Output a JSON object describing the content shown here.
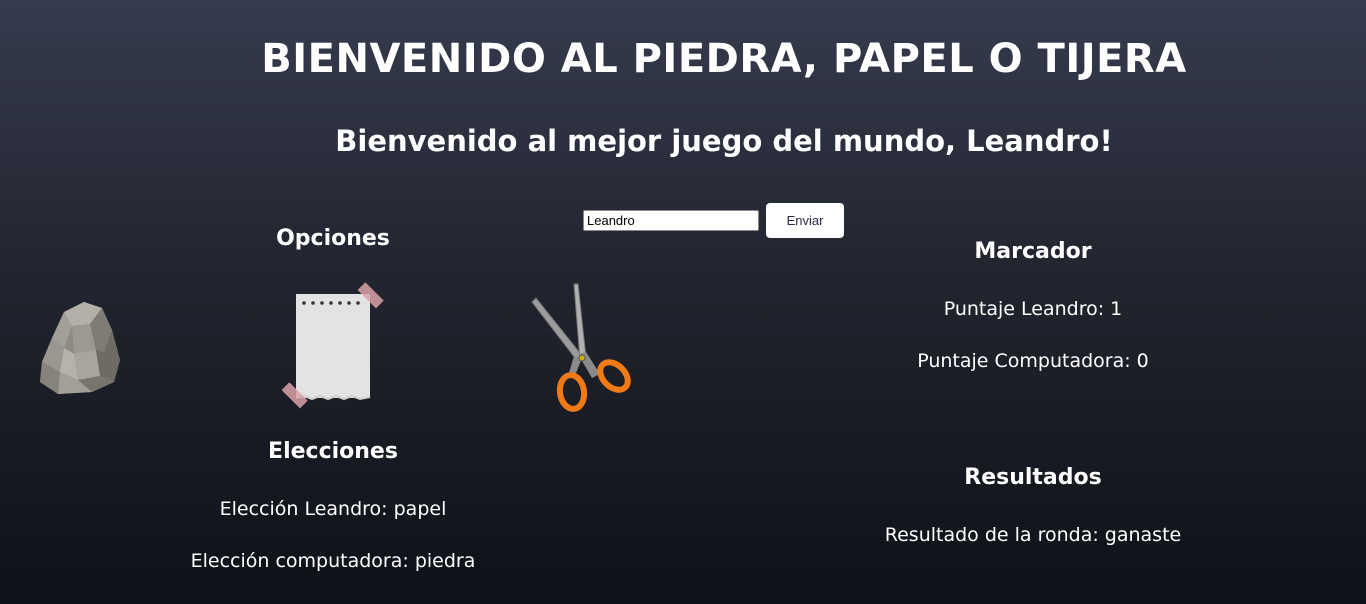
{
  "header": {
    "title": "BIENVENIDO AL PIEDRA, PAPEL O TIJERA",
    "greeting": "Bienvenido al mejor juego del mundo, Leandro!"
  },
  "name_form": {
    "input_value": "Leandro",
    "submit_label": "Enviar"
  },
  "options": {
    "heading": "Opciones",
    "items": [
      {
        "name": "piedra",
        "icon": "rock-icon"
      },
      {
        "name": "papel",
        "icon": "paper-icon"
      },
      {
        "name": "tijera",
        "icon": "scissors-icon"
      }
    ]
  },
  "choices": {
    "heading": "Elecciones",
    "player_choice": "Elección Leandro: papel",
    "computer_choice": "Elección computadora: piedra"
  },
  "scoreboard": {
    "heading": "Marcador",
    "player_score": "Puntaje Leandro: 1",
    "computer_score": "Puntaje Computadora: 0"
  },
  "results": {
    "heading": "Resultados",
    "round_result": "Resultado de la ronda: ganaste"
  },
  "colors": {
    "background_top": "#363b4e",
    "background_bottom": "#0f1118",
    "scissors_handle": "#f07a16"
  }
}
